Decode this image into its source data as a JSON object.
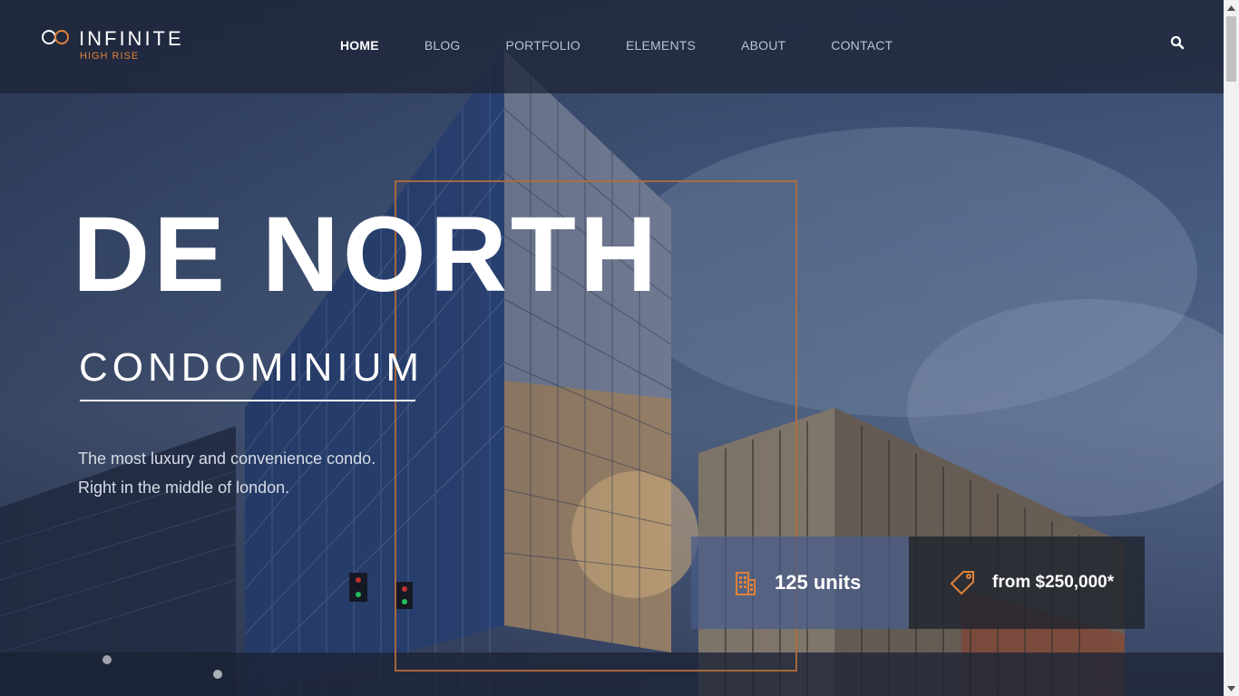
{
  "brand": {
    "name": "INFINITE",
    "tagline": "HIGH RISE",
    "accent_color": "#e0823a"
  },
  "nav": {
    "items": [
      {
        "label": "HOME",
        "active": true
      },
      {
        "label": "BLOG",
        "active": false
      },
      {
        "label": "PORTFOLIO",
        "active": false
      },
      {
        "label": "ELEMENTS",
        "active": false
      },
      {
        "label": "ABOUT",
        "active": false
      },
      {
        "label": "CONTACT",
        "active": false
      }
    ],
    "search_icon": "search-icon"
  },
  "hero": {
    "title": "DE NORTH",
    "subtitle": "CONDOMINIUM",
    "description_line1": "The most luxury and convenience condo.",
    "description_line2": "Right in the middle of london."
  },
  "info": {
    "units": {
      "icon": "building-icon",
      "label": "125 units"
    },
    "price": {
      "icon": "price-tag-icon",
      "label": "from $250,000*"
    }
  }
}
